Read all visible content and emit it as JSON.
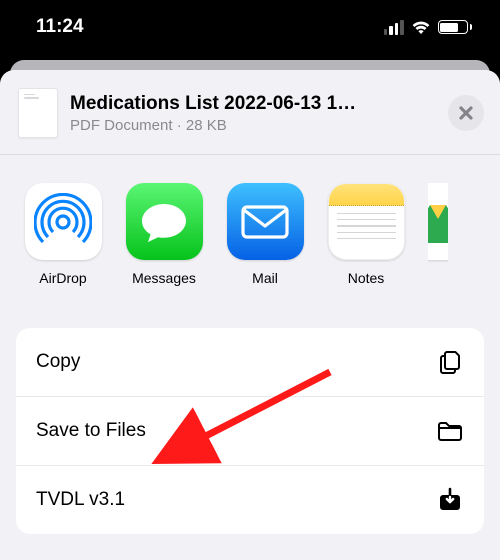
{
  "status": {
    "time": "11:24"
  },
  "doc": {
    "title": "Medications List 2022-06-13 1…",
    "subtitle": "PDF Document · 28 KB"
  },
  "apps": [
    {
      "id": "airdrop",
      "label": "AirDrop"
    },
    {
      "id": "messages",
      "label": "Messages"
    },
    {
      "id": "mail",
      "label": "Mail"
    },
    {
      "id": "notes",
      "label": "Notes"
    }
  ],
  "actions": [
    {
      "id": "copy",
      "label": "Copy"
    },
    {
      "id": "files",
      "label": "Save to Files"
    },
    {
      "id": "tvdl",
      "label": "TVDL v3.1"
    }
  ]
}
